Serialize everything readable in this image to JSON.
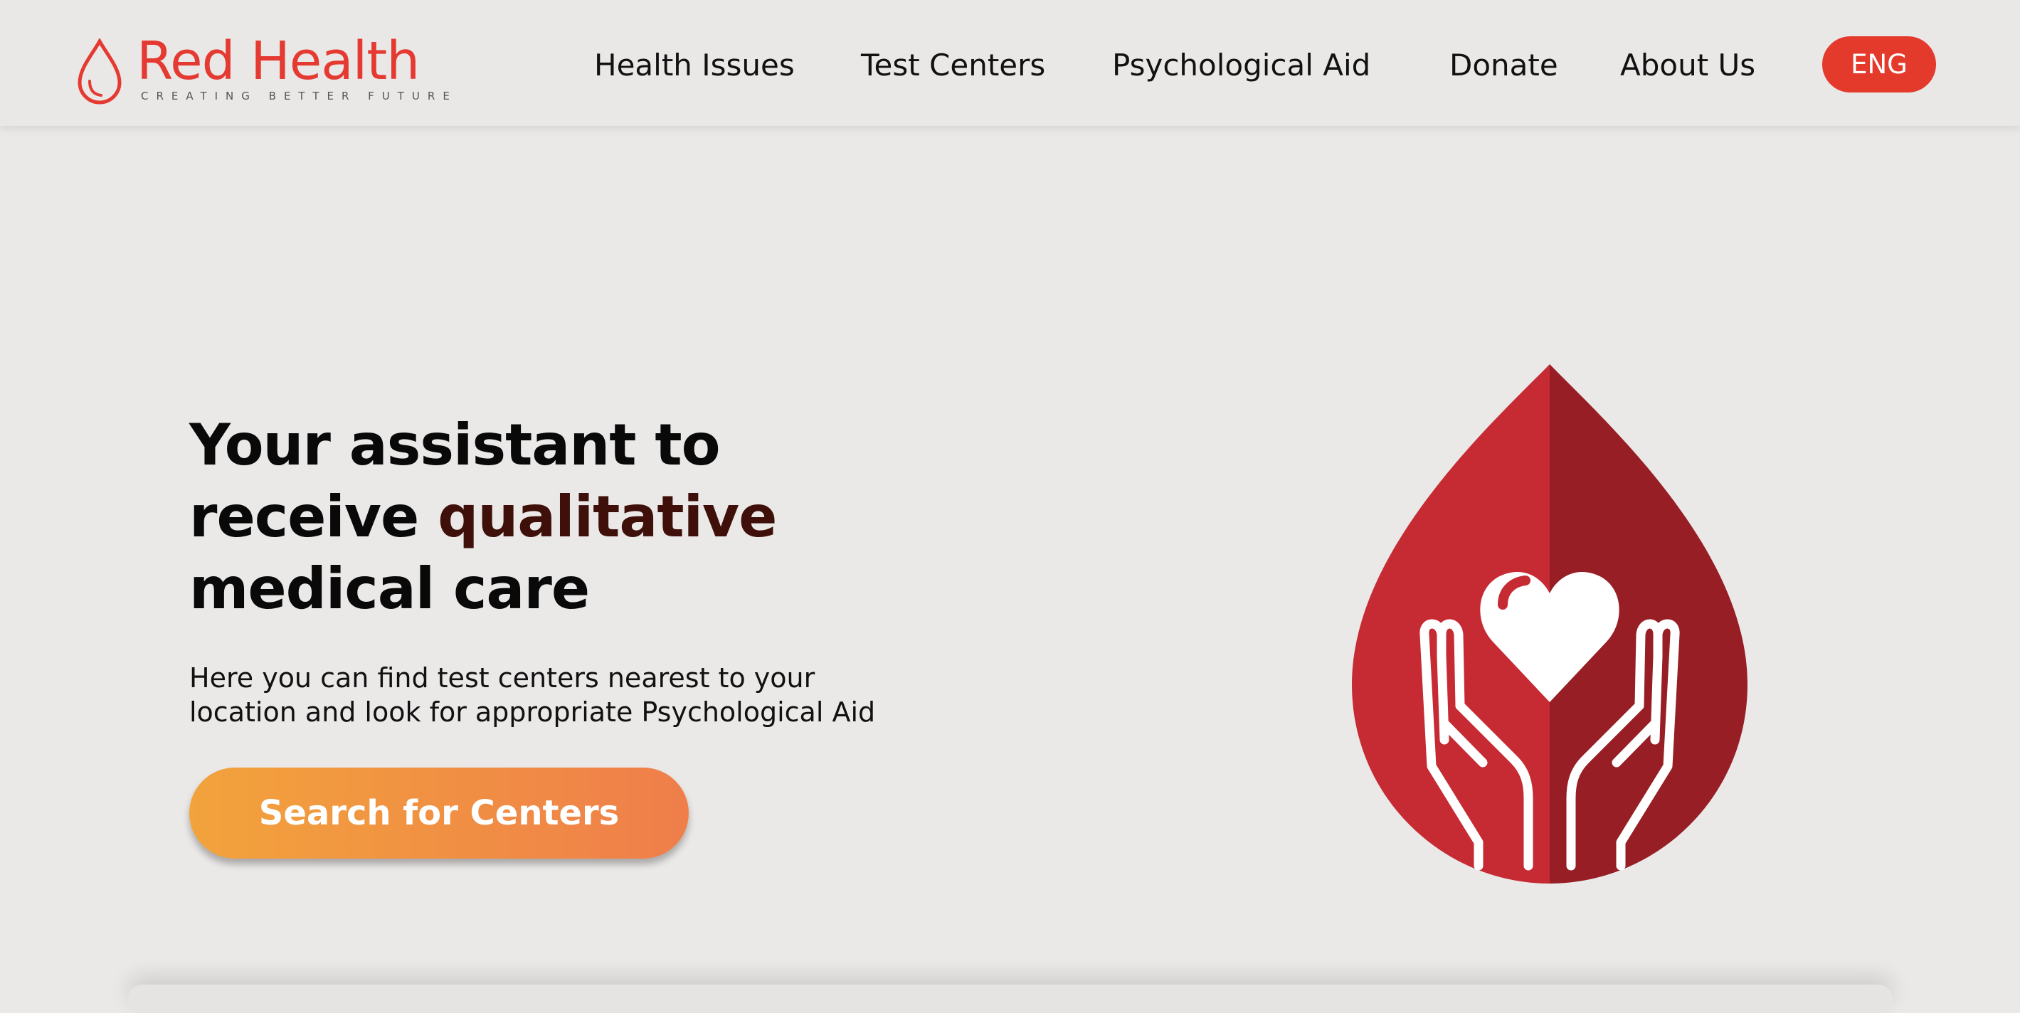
{
  "brand": {
    "name": "Red Health",
    "tagline": "CREATING   BETTER   FUTURE",
    "color": "#e43a32"
  },
  "nav": {
    "items": [
      {
        "label": "Health Issues"
      },
      {
        "label": "Test Centers"
      },
      {
        "label": "Psychological Aid"
      },
      {
        "label": "Donate"
      },
      {
        "label": "About Us"
      }
    ],
    "language": "ENG"
  },
  "hero": {
    "title_line1": "Your assistant to",
    "title_line2_prefix": "receive ",
    "title_line2_accent": "qualitative",
    "title_line3": "medical care",
    "description_line1": "Here you can find test centers nearest to your",
    "description_line2": "location and look for appropriate Psychological Aid",
    "cta_label": "Search for Centers"
  },
  "illustration": {
    "icon": "blood-drop-hands-heart-icon",
    "colors": {
      "left": "#c62a33",
      "right": "#961e24",
      "lines": "#ffffff"
    }
  }
}
